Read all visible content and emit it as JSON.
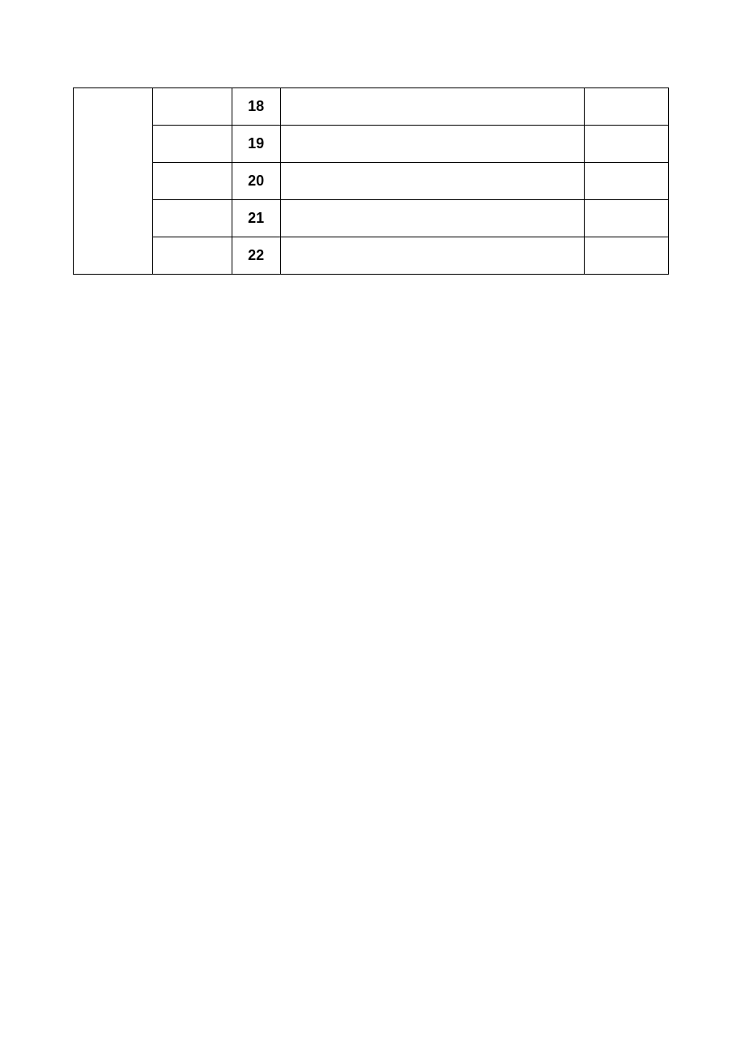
{
  "table": {
    "rows": [
      {
        "col1": "",
        "col2": "",
        "col3": "18",
        "col4": "",
        "col5": ""
      },
      {
        "col1": "",
        "col2": "",
        "col3": "19",
        "col4": "",
        "col5": ""
      },
      {
        "col1": "",
        "col2": "",
        "col3": "20",
        "col4": "",
        "col5": ""
      },
      {
        "col1": "",
        "col2": "",
        "col3": "21",
        "col4": "",
        "col5": ""
      },
      {
        "col1": "",
        "col2": "",
        "col3": "22",
        "col4": "",
        "col5": ""
      }
    ]
  }
}
